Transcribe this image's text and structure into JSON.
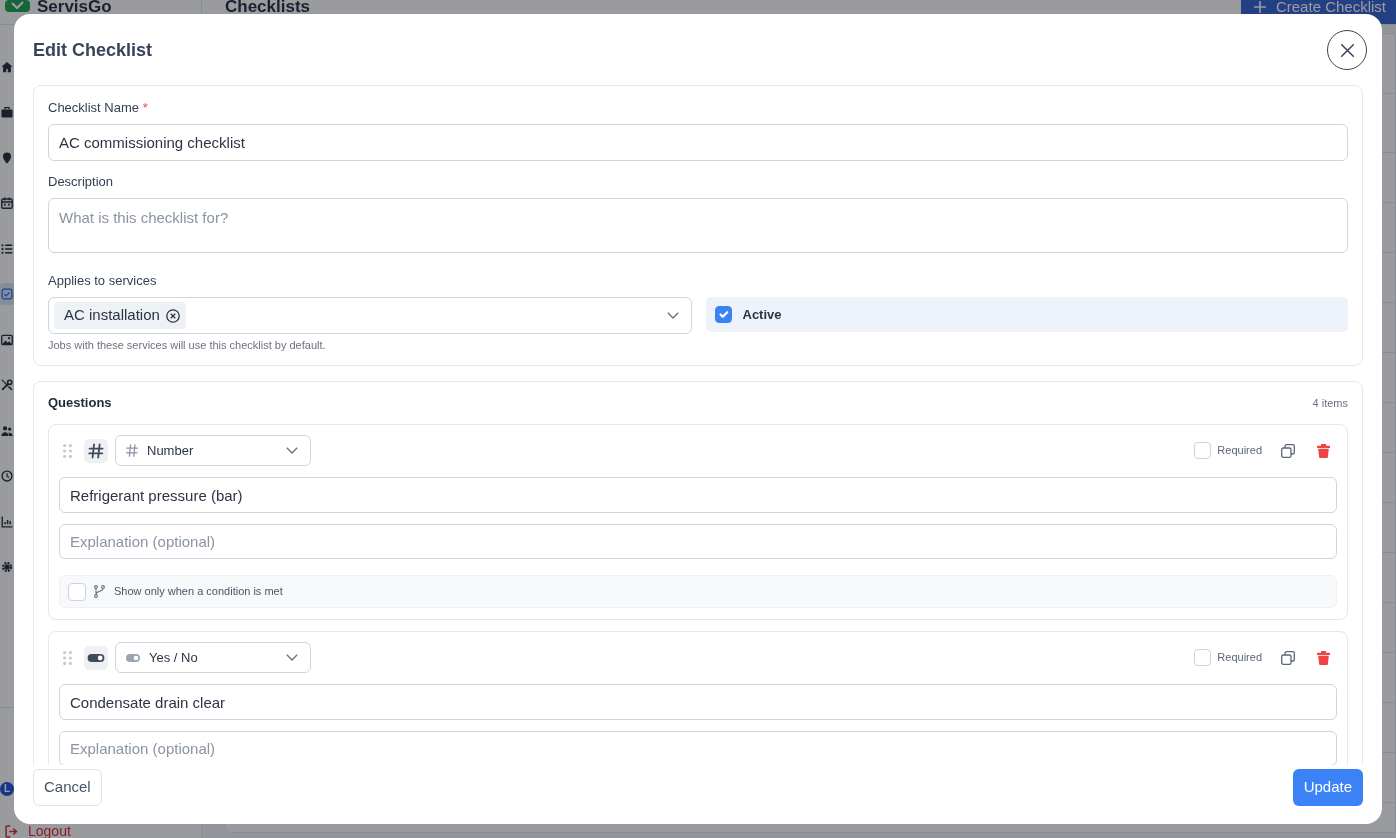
{
  "app": {
    "logo_text": "ServisGo",
    "sidebar": {
      "items": [
        {
          "kind": "home",
          "selected": false
        },
        {
          "kind": "briefcase",
          "selected": false
        },
        {
          "kind": "pin",
          "selected": false
        },
        {
          "kind": "calendar",
          "selected": false
        },
        {
          "kind": "list",
          "selected": false
        },
        {
          "kind": "checklist",
          "selected": true
        },
        {
          "kind": "image",
          "selected": false
        },
        {
          "kind": "tools",
          "selected": false
        },
        {
          "kind": "users",
          "selected": false
        },
        {
          "kind": "clock",
          "selected": false
        },
        {
          "kind": "chart",
          "selected": false
        },
        {
          "kind": "gear",
          "selected": false
        }
      ],
      "user_initial": "L",
      "logout": "Logout"
    },
    "page_title": "Checklists",
    "create_button": "Create Checklist"
  },
  "dialog": {
    "title": "Edit Checklist",
    "form": {
      "name": {
        "label": "Checklist Name",
        "required_mark": "*",
        "value": "AC commissioning checklist"
      },
      "description": {
        "label": "Description",
        "placeholder": "What is this checklist for?"
      },
      "services": {
        "label": "Applies to services",
        "chips": [
          "AC installation"
        ],
        "help": "Jobs with these services will use this checklist by default."
      },
      "active": {
        "label": "Active",
        "checked": true
      }
    },
    "questions": {
      "title": "Questions",
      "count": "4 items",
      "items": [
        {
          "kind": "number",
          "type_label": "Number",
          "required_label": "Required",
          "required": false,
          "text": "Refrigerant pressure (bar)",
          "explanation_placeholder": "Explanation (optional)",
          "condition": {
            "label": "Show only when a condition is met",
            "checked": false
          }
        },
        {
          "kind": "yes_no",
          "type_label": "Yes / No",
          "required_label": "Required",
          "required": false,
          "text": "Condensate drain clear",
          "explanation_placeholder": "Explanation (optional)"
        }
      ]
    },
    "buttons": [
      {
        "kind": "cancel",
        "label": "Cancel"
      },
      {
        "kind": "submit",
        "label": "Update"
      }
    ]
  }
}
